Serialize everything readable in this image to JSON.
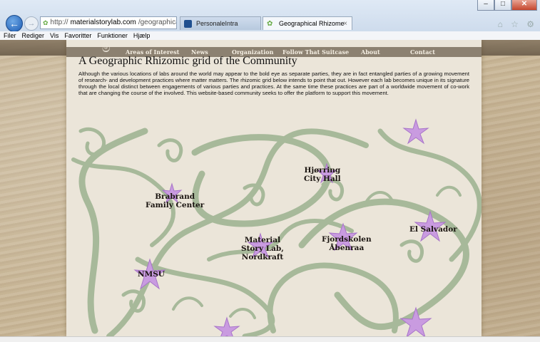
{
  "browser": {
    "url_prefix": "http://",
    "url_host": "materialstorylab.com",
    "url_path": "/geographical-rhizor",
    "url_icons": "⌕ ▾ ↻",
    "tabs": [
      {
        "label": "PersonaleIntra"
      },
      {
        "label": "Geographical Rhizome",
        "close": "×"
      }
    ],
    "menu": [
      "Filer",
      "Rediger",
      "Vis",
      "Favoritter",
      "Funktioner",
      "Hjælp"
    ],
    "window_controls": {
      "minimize": "–",
      "maximize": "□",
      "close": "✕"
    },
    "toolbar_icons": "⌂ ☆ ⚙"
  },
  "site": {
    "logo": "ම",
    "nav": [
      "Areas of Interest",
      "News",
      "Organization",
      "Follow That Suitcase",
      "About",
      "Contact"
    ],
    "title": "A Geographic Rhizomic grid of the Community",
    "intro": "Although the various locations of labs around the world may appear to the bold eye as separate parties, they are in fact entangled parties of a growing movement of research- and development practices where matter matters. The rhizomic grid below intends to point that out. However each lab becomes unique in its signature through the local distinct between engagements of various parties and practices. At the same time these practices are part of a worldwide movement of co-work that are changing the course of the involved. This website-based community seeks to offer the platform to support this movement."
  },
  "map": {
    "vine_color": "#a7b99a",
    "flower_color": "#c99be0",
    "locations": [
      {
        "line1": "Hjørring",
        "line2": "City Hall"
      },
      {
        "line1": "Brabrand",
        "line2": "Family Center"
      },
      {
        "line1": "El Salvador",
        "line2": ""
      },
      {
        "line1": "Material",
        "line2": "Story Lab,",
        "line3": "Nordkraft"
      },
      {
        "line1": "Fjordskolen",
        "line2": "Åbenraa"
      },
      {
        "line1": "NMSU",
        "line2": ""
      }
    ]
  }
}
